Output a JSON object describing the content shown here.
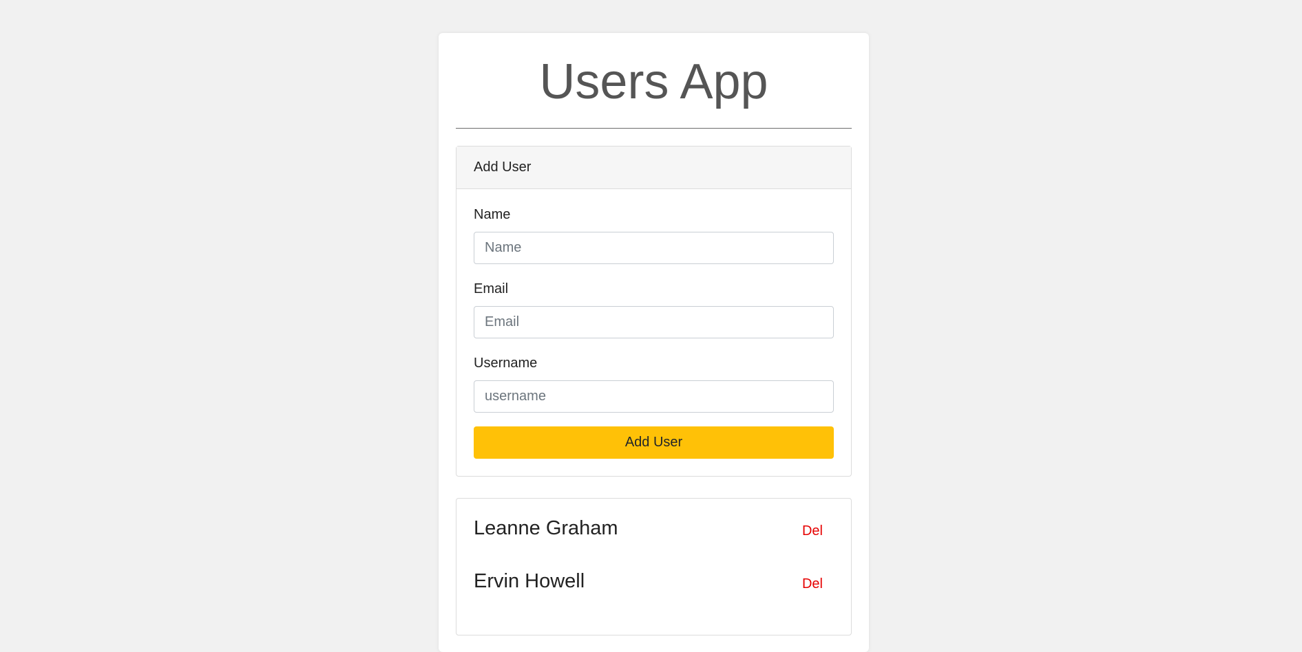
{
  "app": {
    "title": "Users App"
  },
  "add_user_form": {
    "header": "Add User",
    "fields": [
      {
        "label": "Name",
        "placeholder": "Name",
        "value": ""
      },
      {
        "label": "Email",
        "placeholder": "Email",
        "value": ""
      },
      {
        "label": "Username",
        "placeholder": "username",
        "value": ""
      }
    ],
    "submit_label": "Add User",
    "submit_color": "#ffc107"
  },
  "users": [
    {
      "name": "Leanne Graham",
      "delete_label": "Del"
    },
    {
      "name": "Ervin Howell",
      "delete_label": "Del"
    }
  ],
  "colors": {
    "background": "#f1f1f1",
    "delete": "#e60000"
  }
}
